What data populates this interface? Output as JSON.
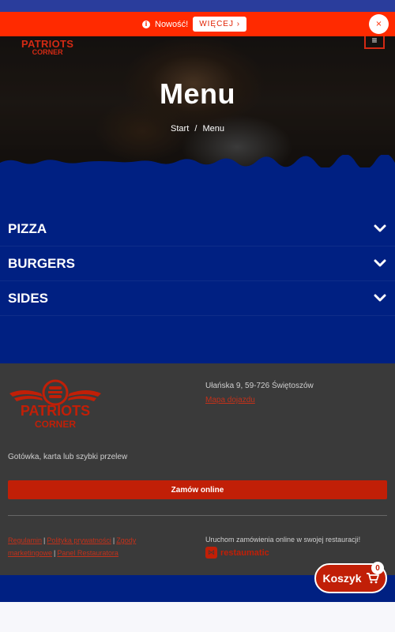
{
  "announcement": {
    "text": "Nowość!",
    "more_label": "WIĘCEJ ›",
    "close_glyph": "×",
    "info_glyph": "i"
  },
  "header": {
    "logo_line1": "PATRIOTS",
    "logo_line2": "CORNER",
    "menu_glyph": "≡"
  },
  "hero": {
    "title": "Menu",
    "breadcrumb": [
      "Start",
      "/",
      "Menu"
    ]
  },
  "categories": [
    {
      "label": "PIZZA",
      "icon": "chevron-down-icon"
    },
    {
      "label": "BURGERS",
      "icon": "chevron-down-icon"
    },
    {
      "label": "SIDES",
      "icon": "chevron-down-icon"
    }
  ],
  "footer": {
    "logo_line1": "PATRIOTS",
    "logo_line2": "CORNER",
    "address": "Ułańska 9, 59-726 Świętoszów",
    "map_link": "Mapa dojazdu",
    "payment": "Gotówka, karta lub szybki przelew",
    "order_button": "Zamów online",
    "links": [
      "Regulamin",
      "Polityka prywatności",
      "Zgody marketingowe",
      "Panel Restauratora"
    ],
    "link_separator": "|",
    "promo_text": "Uruchom zamówienia online w swojej restauracji!",
    "brand_name": "restaumatic",
    "brand_glyph": "⋈"
  },
  "cart": {
    "label": "Koszyk",
    "count": "0"
  },
  "colors": {
    "brand_red": "#c11f07",
    "announcement_red": "#ff2a00",
    "menu_blue": "#002082",
    "footer_gray": "#3a3a3a"
  }
}
